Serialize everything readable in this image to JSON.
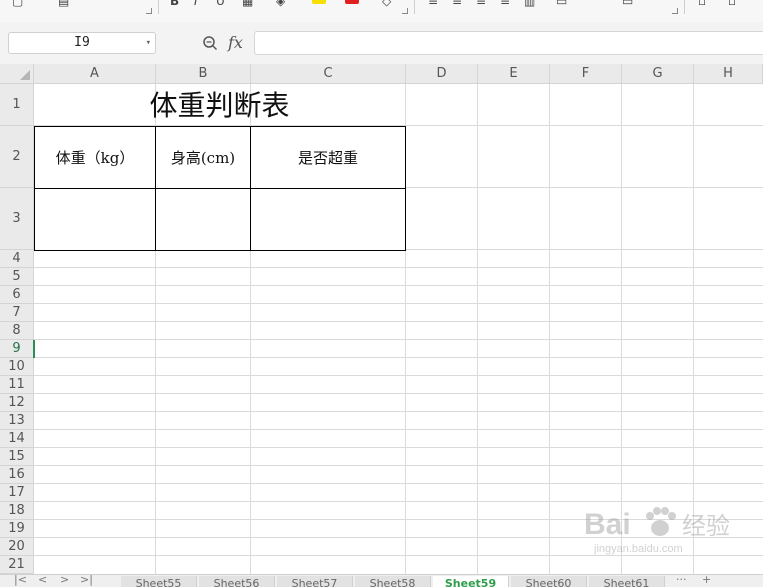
{
  "formula_bar": {
    "cell_ref": "I9",
    "fx_label": "fx",
    "formula_value": ""
  },
  "grid": {
    "columns": [
      "A",
      "B",
      "C",
      "D",
      "E",
      "F",
      "G",
      "H"
    ],
    "rows": [
      "1",
      "2",
      "3",
      "4",
      "5",
      "6",
      "7",
      "8",
      "9",
      "10",
      "11",
      "12",
      "13",
      "14",
      "15",
      "16",
      "17",
      "18",
      "19",
      "20",
      "21"
    ],
    "active_row": "9",
    "active_cell": "I9"
  },
  "table": {
    "title": "体重判断表",
    "headers": [
      "体重（kg）",
      "身高(cm)",
      "是否超重"
    ],
    "row3": [
      "",
      "",
      ""
    ]
  },
  "sheets": {
    "tabs": [
      "Sheet55",
      "Sheet56",
      "Sheet57",
      "Sheet58",
      "Sheet59",
      "Sheet60",
      "Sheet61"
    ],
    "active": "Sheet59",
    "more_label": "···",
    "add_label": "+"
  },
  "colors": {
    "accent": "#2e9e4a",
    "grid_line": "#dadada",
    "header_bg": "#eaeaea"
  },
  "watermark": {
    "brand": "Bai",
    "brand_cn": "经验",
    "url": "jingyan.baidu.com"
  }
}
